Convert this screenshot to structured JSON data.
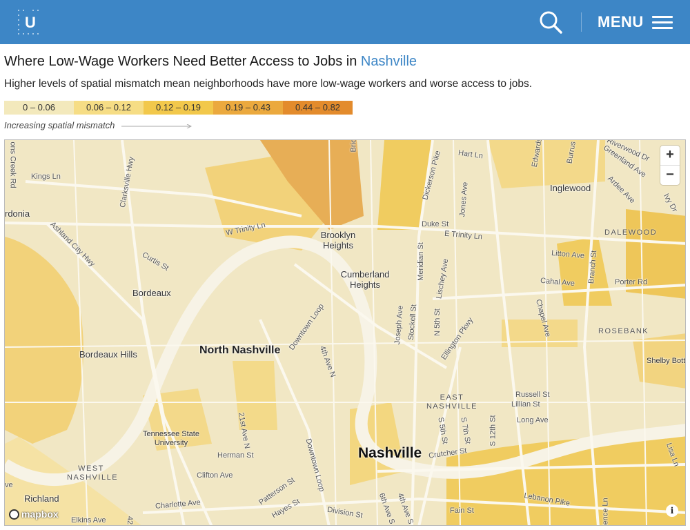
{
  "header": {
    "logo_letter": "U",
    "menu_label": "MENU"
  },
  "title": {
    "prefix": "Where Low-Wage Workers Need Better Access to Jobs in",
    "city": "Nashville"
  },
  "subtitle": "Higher levels of spatial mismatch mean neighborhoods have more low-wage workers and worse access to jobs.",
  "legend": {
    "bins": [
      {
        "label": "0 – 0.06",
        "color": "#f3e9bc"
      },
      {
        "label": "0.06 – 0.12",
        "color": "#f6dd85"
      },
      {
        "label": "0.12 – 0.19",
        "color": "#f2c84b"
      },
      {
        "label": "0.19 – 0.43",
        "color": "#eba93e"
      },
      {
        "label": "0.44 – 0.82",
        "color": "#e38b2c"
      }
    ],
    "note": "Increasing spatial mismatch"
  },
  "map": {
    "places": {
      "nashville": "Nashville",
      "north_nashville": "North Nashville",
      "bordeaux": "Bordeaux",
      "bordeaux_hills": "Bordeaux Hills",
      "brooklyn_heights": "Brooklyn Heights",
      "cumberland_heights": "Cumberland Heights",
      "inglewood": "Inglewood",
      "tsu": "Tennessee State University",
      "richland": "Richland",
      "shelby_bottoms": "Shelby Bott",
      "cardonia": "rdonia"
    },
    "neighborhoods": {
      "dalewood": "DALEWOOD",
      "rosebank": "ROSEBANK",
      "east_nashville": "EAST NASHVILLE",
      "west_nashville": "WEST NASHVILLE"
    },
    "streets": {
      "kings_ln": "Kings Ln",
      "clarksville_hwy": "Clarksville Hwy",
      "ashland_city_hwy": "Ashland City Hwy",
      "w_trinity_ln": "W Trinity Ln",
      "curtis_st": "Curtis St",
      "downtown_loop_1": "Downtown Loop",
      "downtown_loop_2": "Downtown Loop",
      "fourth_ave_n": "4th Ave N",
      "twentyfirst_ave_n": "21st Ave N",
      "herman_st": "Herman St",
      "clifton_ave": "Clifton Ave",
      "patterson_st": "Patterson St",
      "charlotte_ave": "Charlotte Ave",
      "hayes_st": "Hayes St",
      "elkins_ave": "Elkins Ave",
      "division_st": "Division St",
      "sixth_ave_s": "6th Ave S",
      "fourth_ave_s": "4th Ave S",
      "fain_st": "Fain St",
      "lebanon_pike": "Lebanon Pike",
      "crutcher_st": "Crutcher St",
      "fifth_st": "S 5th St",
      "seventh_st": "S 7th St",
      "twelfth_st": "S 12th St",
      "long_ave": "Long Ave",
      "lillian_st": "Lillian St",
      "russell_st": "Russell St",
      "chapel_ave": "Chapel Ave",
      "ellington_pkwy": "Ellington Pkwy",
      "n_fifth_st": "N 5th St",
      "lischey_ave": "Lischey Ave",
      "stockell_st": "Stockell St",
      "joseph_ave": "Joseph Ave",
      "meridian_st": "Meridian St",
      "duke_st": "Duke St",
      "e_trinity_ln": "E Trinity Ln",
      "dickerson_pike": "Dickerson Pike",
      "jones_ave": "Jones Ave",
      "hart_ln": "Hart Ln",
      "edwards": "Edwards",
      "burrus": "Burrus",
      "riverwood_dr": "Riverwood Dr",
      "greenland_ave": "Greenland Ave",
      "ardee_ave": "Ardee Ave",
      "ivy_dr": "Ivy Dr",
      "litton_ave": "Litton Ave",
      "branch_st": "Branch St",
      "cahal_ave": "Cahal Ave",
      "porter_rd": "Porter Rd",
      "lisa_ln": "Lisa Ln",
      "creek_rd": "ons Creek Rd",
      "brick": "Bric",
      "ve": "ve",
      "num42": "42",
      "dence_ln": "dence Ln"
    },
    "attribution": "mapbox",
    "zoom_in": "+",
    "zoom_out": "−",
    "info": "i"
  }
}
